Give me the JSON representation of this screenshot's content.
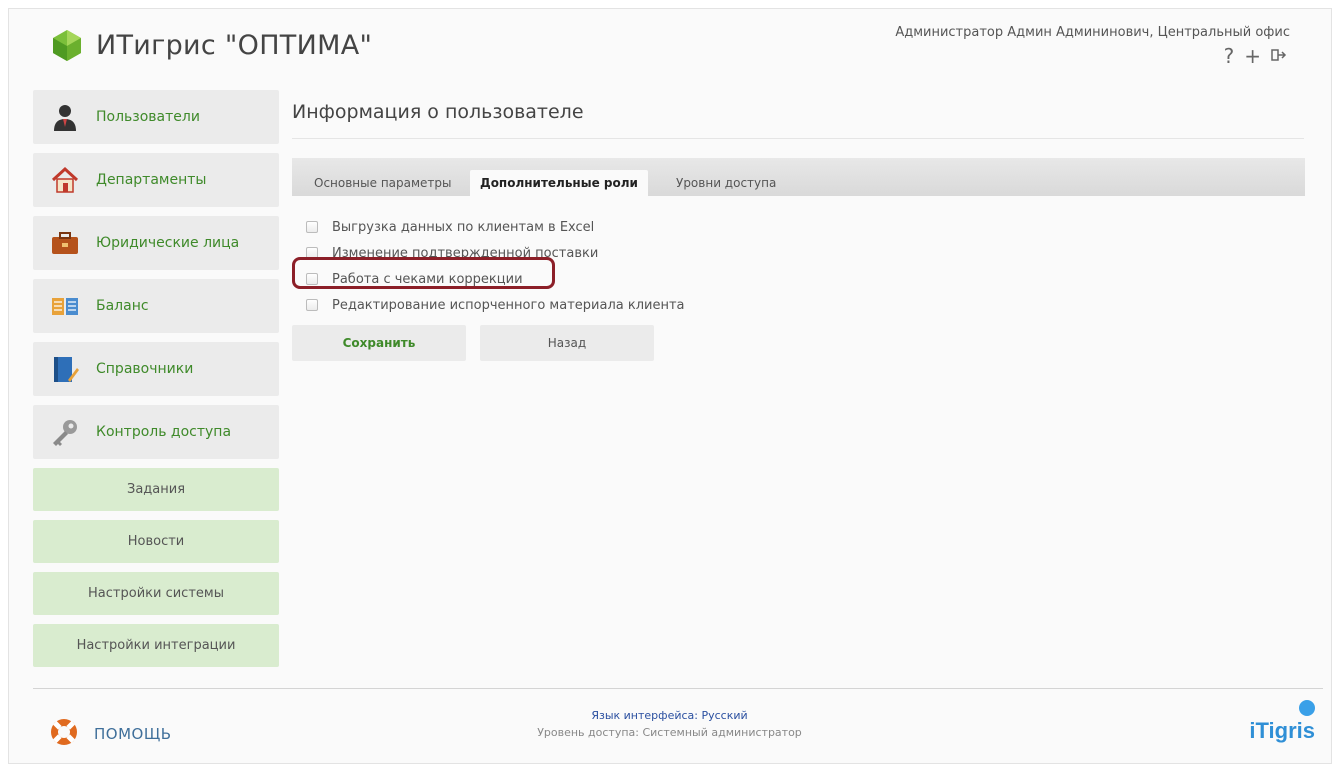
{
  "header": {
    "app_title": "ИТигрис \"ОПТИМА\"",
    "user_info": "Администратор Админ Админинович, Центральный офис",
    "icons": {
      "help": "?",
      "add": "+",
      "logout": "⇨"
    }
  },
  "sidebar": {
    "items": [
      {
        "label": "Пользователи",
        "icon": "user-icon"
      },
      {
        "label": "Департаменты",
        "icon": "home-icon"
      },
      {
        "label": "Юридические лица",
        "icon": "briefcase-icon"
      },
      {
        "label": "Баланс",
        "icon": "balance-icon"
      },
      {
        "label": "Справочники",
        "icon": "book-icon"
      },
      {
        "label": "Контроль доступа",
        "icon": "key-icon"
      }
    ],
    "green_items": [
      {
        "label": "Задания"
      },
      {
        "label": "Новости"
      },
      {
        "label": "Настройки системы"
      },
      {
        "label": "Настройки интеграции"
      }
    ]
  },
  "main": {
    "title": "Информация о пользователе",
    "tabs": [
      {
        "label": "Основные параметры",
        "active": false
      },
      {
        "label": "Дополнительные роли",
        "active": true
      },
      {
        "label": "Уровни доступа",
        "active": false
      }
    ],
    "roles": [
      {
        "label": "Выгрузка данных по клиентам в Excel",
        "checked": false
      },
      {
        "label": "Изменение подтвержденной поставки",
        "checked": false
      },
      {
        "label": "Работа с чеками коррекции",
        "checked": false,
        "highlighted": true
      },
      {
        "label": "Редактирование испорченного материала клиента",
        "checked": false
      }
    ],
    "save_label": "Сохранить",
    "back_label": "Назад"
  },
  "footer": {
    "help_label": "ПОМОЩЬ",
    "language": "Язык интерфейса: Русский",
    "access_level": "Уровень доступа: Системный администратор",
    "brand": "iTigris"
  },
  "colors": {
    "accent_green": "#3f8a2a",
    "nav_green_bg": "#d9eccf",
    "highlight_border": "#8c1f28",
    "brand_blue": "#2f8fd6"
  }
}
